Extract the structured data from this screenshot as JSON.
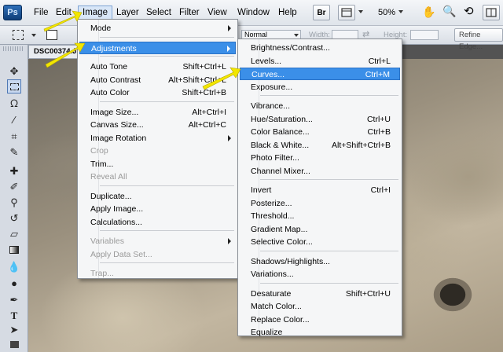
{
  "app": {
    "logo": "Ps"
  },
  "menubar": {
    "items": [
      "File",
      "Edit",
      "Image",
      "Layer",
      "Select",
      "Filter",
      "View",
      "Window",
      "Help"
    ],
    "active": "Image",
    "bridge_label": "Br",
    "zoom": "50%"
  },
  "options": {
    "style_value": "Normal",
    "width_label": "Width:",
    "height_label": "Height:",
    "refine_edge": "Refine Edge..."
  },
  "document": {
    "tab_title": "DSC00374.JPG"
  },
  "image_menu": [
    {
      "label": "Mode",
      "shortcut": "",
      "submenu": true
    },
    {
      "separator": true
    },
    {
      "label": "Adjustments",
      "shortcut": "",
      "submenu": true,
      "highlighted": true
    },
    {
      "separator": true
    },
    {
      "label": "Auto Tone",
      "shortcut": "Shift+Ctrl+L"
    },
    {
      "label": "Auto Contrast",
      "shortcut": "Alt+Shift+Ctrl+L"
    },
    {
      "label": "Auto Color",
      "shortcut": "Shift+Ctrl+B"
    },
    {
      "separator": true
    },
    {
      "label": "Image Size...",
      "shortcut": "Alt+Ctrl+I"
    },
    {
      "label": "Canvas Size...",
      "shortcut": "Alt+Ctrl+C"
    },
    {
      "label": "Image Rotation",
      "shortcut": "",
      "submenu": true
    },
    {
      "label": "Crop",
      "shortcut": "",
      "disabled": true
    },
    {
      "label": "Trim...",
      "shortcut": ""
    },
    {
      "label": "Reveal All",
      "shortcut": "",
      "disabled": true
    },
    {
      "separator": true
    },
    {
      "label": "Duplicate...",
      "shortcut": ""
    },
    {
      "label": "Apply Image...",
      "shortcut": ""
    },
    {
      "label": "Calculations...",
      "shortcut": ""
    },
    {
      "separator": true
    },
    {
      "label": "Variables",
      "shortcut": "",
      "submenu": true,
      "disabled": true
    },
    {
      "label": "Apply Data Set...",
      "shortcut": "",
      "disabled": true
    },
    {
      "separator": true
    },
    {
      "label": "Trap...",
      "shortcut": "",
      "disabled": true
    }
  ],
  "adjustments_menu": [
    {
      "label": "Brightness/Contrast...",
      "shortcut": ""
    },
    {
      "label": "Levels...",
      "shortcut": "Ctrl+L"
    },
    {
      "label": "Curves...",
      "shortcut": "Ctrl+M",
      "highlighted": true
    },
    {
      "label": "Exposure...",
      "shortcut": ""
    },
    {
      "separator": true
    },
    {
      "label": "Vibrance...",
      "shortcut": ""
    },
    {
      "label": "Hue/Saturation...",
      "shortcut": "Ctrl+U"
    },
    {
      "label": "Color Balance...",
      "shortcut": "Ctrl+B"
    },
    {
      "label": "Black & White...",
      "shortcut": "Alt+Shift+Ctrl+B"
    },
    {
      "label": "Photo Filter...",
      "shortcut": ""
    },
    {
      "label": "Channel Mixer...",
      "shortcut": ""
    },
    {
      "separator": true
    },
    {
      "label": "Invert",
      "shortcut": "Ctrl+I"
    },
    {
      "label": "Posterize...",
      "shortcut": ""
    },
    {
      "label": "Threshold...",
      "shortcut": ""
    },
    {
      "label": "Gradient Map...",
      "shortcut": ""
    },
    {
      "label": "Selective Color...",
      "shortcut": ""
    },
    {
      "separator": true
    },
    {
      "label": "Shadows/Highlights...",
      "shortcut": ""
    },
    {
      "label": "Variations...",
      "shortcut": ""
    },
    {
      "separator": true
    },
    {
      "label": "Desaturate",
      "shortcut": "Shift+Ctrl+U"
    },
    {
      "label": "Match Color...",
      "shortcut": ""
    },
    {
      "label": "Replace Color...",
      "shortcut": ""
    },
    {
      "label": "Equalize",
      "shortcut": ""
    }
  ],
  "tools": [
    "move-tool-icon",
    "marquee-tool-icon",
    "lasso-tool-icon",
    "quick-selection-tool-icon",
    "crop-tool-icon",
    "eyedropper-tool-icon",
    "healing-brush-icon",
    "brush-tool-icon",
    "clone-stamp-icon",
    "history-brush-icon",
    "eraser-tool-icon",
    "gradient-tool-icon",
    "blur-tool-icon",
    "dodge-tool-icon",
    "pen-tool-icon",
    "type-tool-icon",
    "path-selection-icon",
    "rectangle-tool-icon"
  ],
  "colors": {
    "highlight": "#3b8fe8",
    "annotation_arrow": "#f2e600"
  }
}
